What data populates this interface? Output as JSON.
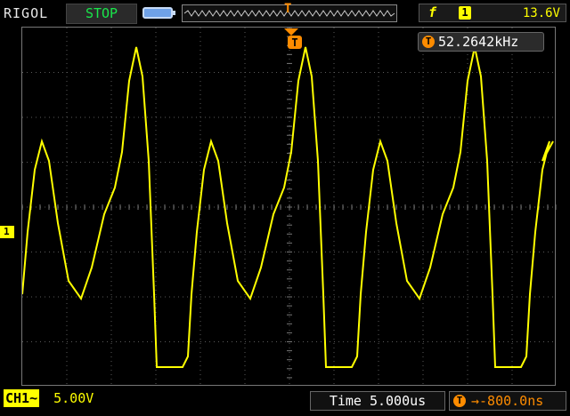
{
  "header": {
    "brand": "RIGOL",
    "run_state": "STOP",
    "trigger_pos_marker": "T",
    "trigger": {
      "edge_symbol": "f",
      "source": "1",
      "level": "13.6V"
    }
  },
  "screen": {
    "channel_marker": "1",
    "trigger_marker": "T",
    "frequency_icon": "T",
    "frequency": "52.2642kHz"
  },
  "footer": {
    "channel_tag": "CH1",
    "channel_coupling_icon": "~",
    "volts_per_div": "5.00V",
    "timebase": "Time 5.000us",
    "offset_icon": "T",
    "offset": "→-800.0ns"
  },
  "colors": {
    "trace": "#ffff00",
    "trigger": "#ff8c00",
    "run_state": "#19e64b"
  }
}
